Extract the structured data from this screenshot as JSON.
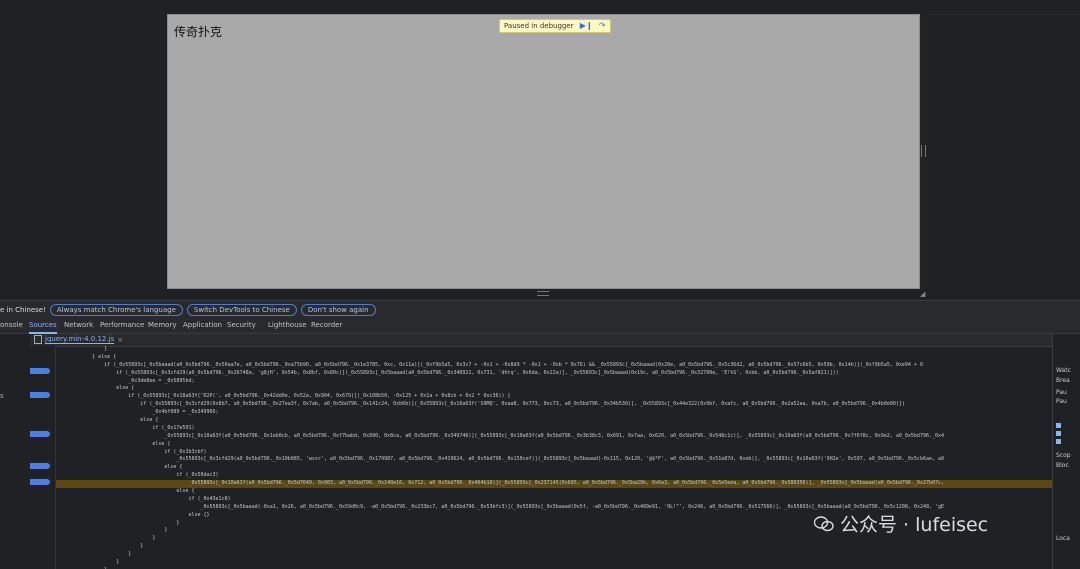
{
  "page": {
    "title": "传奇扑克",
    "paused_label": "Paused in debugger"
  },
  "langbar": {
    "message": "e in Chinese!",
    "buttons": [
      "Always match Chrome's language",
      "Switch DevTools to Chinese",
      "Don't show again"
    ]
  },
  "tabs": [
    "onsole",
    "Sources",
    "Network",
    "Performance",
    "Memory",
    "Application",
    "Security",
    "Lighthouse",
    "Recorder"
  ],
  "active_tab": "Sources",
  "file": {
    "name": "jquery.min-4.0.12.js"
  },
  "nav": {
    "item": "s"
  },
  "code_lines": [
    "                }",
    "            } else {",
    "                if (_0x55893c[_0x5baaad(a0_0x5bd796._0x50aa7e, a0_0x5bd796._0xa75b90, a0_0x5bd796._0x1e3785, 0xc, 0x11a)](_0xf9b5a5, 0x3c7 + -0x1 + -0x8d9 * -0x1 + -0xb * 0x76) && _0x55893c[_0x5baaad(0x20e, a0_0x5bd796._0x5c36d2, a0_0x5bd796._0x57c6b5, 0x59b, 0x14b)](_0xf9b5a5, 0xe94 + 0",
    "                    if (_0x55893c[_0x3cfd29(a0_0x5bd796._0x26748a, 'g8jH', 0x54b, 0x8bf, 0x80c)](_0x55893c[_0x5baaad(a0_0x5bd796._0x340921, 0x731, 'dhtq', 0x6da, 0x22a)], _0x55893c[_0x5baaad(0x19c, a0_0x5bd796._0x32700e, 'E!%S', 0xbb, a0_0x5bd796._0x5af821)]))",
    "                        _0x3de8ee = _0x5895bd;",
    "                    else {",
    "                        if (_0x55893c[_0x18a63f('D2P(', a0_0x5bd796._0x42dd0e, 0x52a, 0x904, 0x679)](_0x108b50, -0x125 + 0x1a + 0x8cb + 0x2 * 0xc36)) {",
    "                            if (_0x55893c[_0x3cfd29(0x8b7, a0_0x5bd796._0x27ea3f, 0x7ab, a0_0x5bd796._0x141c24, 0xb6b)](_0x55893c[_0x10a63f('S9MQ', 0xaa8, 0x773, 0xc73, a0_0x5bd796._0x34b530)], _0x55893c[_0x44e322(0x9bf, 0xafc, a0_0x5bd796._0x2a52aa, 0xa7b, a0_0x5bd796._0x4b0e00)])",
    "                                _0x4bf089 = _0x349966;",
    "                            else {",
    "                                if (_0x17e501)",
    "                                    _0x55893c[_0x10a63f(a0_0x5bd796._0x1eb0cb, a0_0x5bd796._0xf7babd, 0x890, 0x8ca, a0_0x5bd796._0x349746)](_0x55893c[_0x10a63f(a0_0x5bd796._0x3b38c3, 0x691, 0x7aa, 0x620, a0_0x5bd796._0x548c1c)], _0x55893c[_0x10a63f(a0_0x5bd796._0x7f6f8c, 0x9e2, a0_0x5bd796._0x4",
    "                                else {",
    "                                    if (_0x3b3cbf)",
    "                                        _0x55893c[_0x3cfd29(a0_0x5bd796._0x10b985, 'wssr', a0_0x5bd796._0x179987, a0_0x5bd796._0x419624, a0_0x5bd796._0x150cef)](_0x55893c[_0x5baaad(-0x115, 0x120, '@$*F', a0_0x5bd796._0x51e87d, 0xeb)], _0x55893c[_0x10a63f('9H2e', 0x597, a0_0x5bd796._0x5cb6ae, a0",
    "                                    else {",
    "                                        if (_0x50dac3)",
    "                                            _0x55893c[_0x10a63f(a0_0x5bd796._0x5d7640, 0x903, a0_0x5bd796._0x140e16, 0x712, a0_0x5bd796._0x404b18)](_0x55893c[_0x237145(0x695, a0_0x5bd796._0x5ba29b, 0x6a3, a0_0x5bd796._0x5e5eea, a0_0x5bd796._0x580356)], _0x55893c[_0x5baaad(a0_0x5bd796._0x27b07c,",
    "                                        else {",
    "                                            if (_0x43e1c8)",
    "                                                _0x55893c[_0x5baaad(-0xa1, 0x26, a0_0x5bd796._0x59d0c9, -a0_0x5bd796._0x233bc7, a0_0x5bd796._0x53bfc3)](_0x55893c[_0x5baaad(0x5f, -a0_0x5bd796._0x489e91, '0L!^', 0x246, a0_0x5bd796._0x517566)], _0x55893c[_0x5baaad(a0_0x5bd796._0x5c1208, 0x248, 'gE",
    "                                            else {}",
    "                                        }",
    "                                    }",
    "                                }",
    "                            }",
    "                        }",
    "                    }",
    "                }"
  ],
  "highlight_line": 17,
  "right_pane": [
    "Watc",
    "Brea",
    "Pau",
    "Pau",
    "Scop",
    "Bloc",
    "Loca"
  ],
  "watermark": {
    "text": "公众号 · lufeisec"
  },
  "colors": {
    "accent": "#8ab4f8",
    "breakpoint": "#4e7fe0",
    "highlight": "#5a4712"
  }
}
